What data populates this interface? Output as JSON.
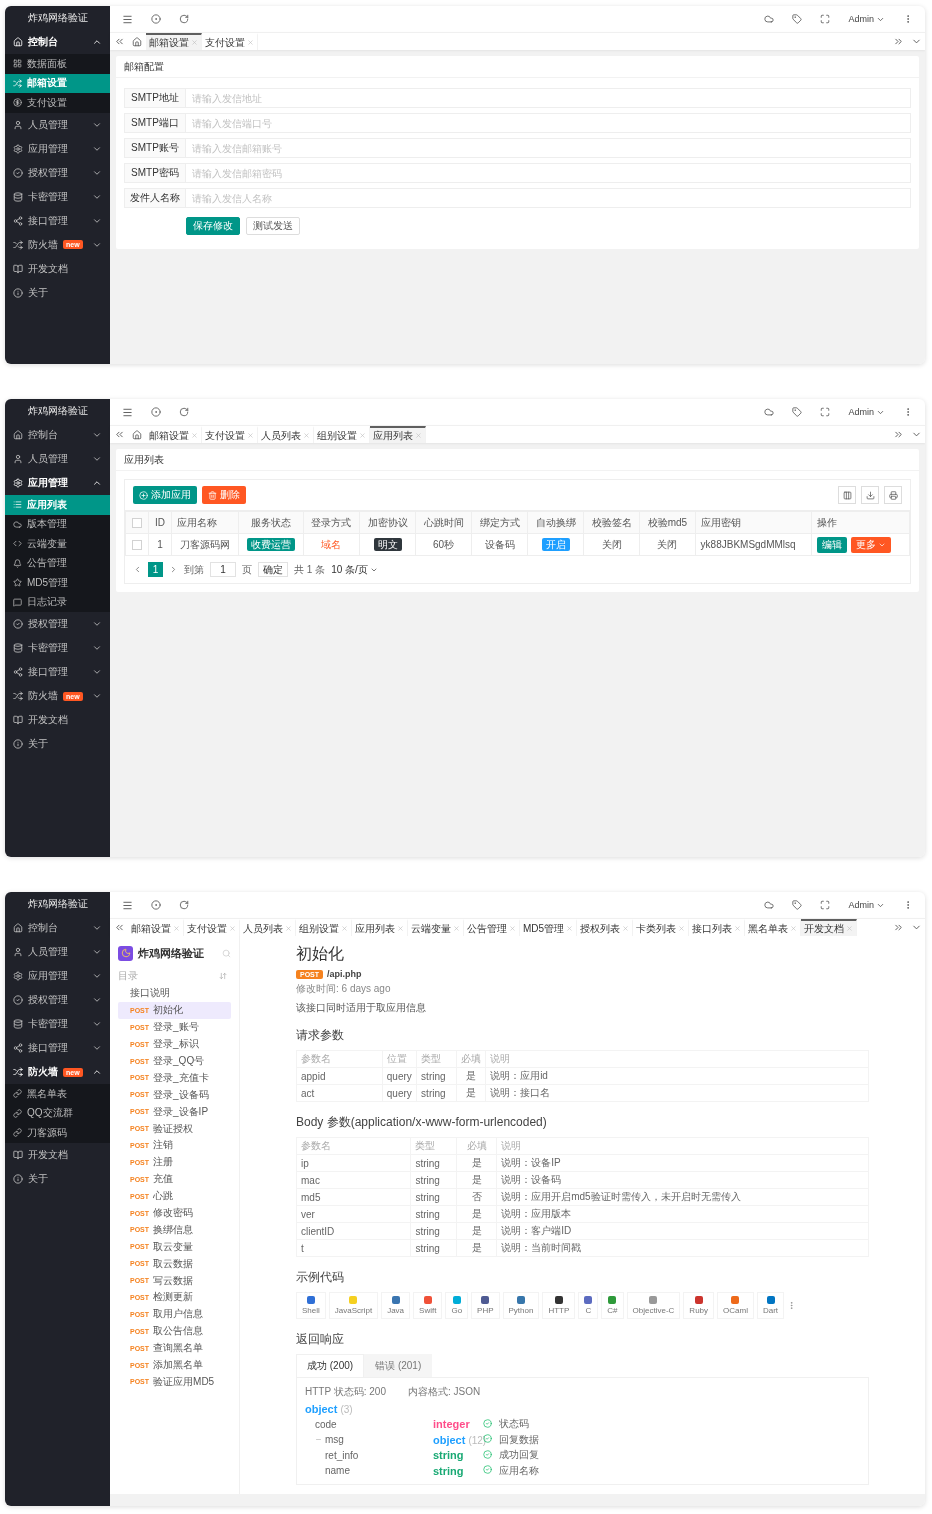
{
  "panels": [
    {
      "brand": "炸鸡网络验证",
      "user": "Admin",
      "sidebar": [
        {
          "label": "控制台",
          "expanded": true,
          "children": [
            {
              "label": "数据面板",
              "selected": false
            },
            {
              "label": "邮箱设置",
              "selected": true
            },
            {
              "label": "支付设置",
              "selected": false
            }
          ]
        },
        {
          "label": "人员管理",
          "expanded": false
        },
        {
          "label": "应用管理",
          "expanded": false
        },
        {
          "label": "授权管理",
          "expanded": false
        },
        {
          "label": "卡密管理",
          "expanded": false
        },
        {
          "label": "接口管理",
          "expanded": false
        },
        {
          "label": "防火墙",
          "badge": "new",
          "expanded": false
        },
        {
          "label": "开发文档"
        },
        {
          "label": "关于"
        }
      ],
      "tabbar": {
        "home": true,
        "tabs": [
          {
            "label": "邮箱设置",
            "selected": true
          },
          {
            "label": "支付设置",
            "selected": false
          }
        ]
      },
      "content": {
        "kind": "form",
        "title": "邮箱配置",
        "fields": [
          {
            "label": "SMTP地址",
            "placeholder": "请输入发信地址"
          },
          {
            "label": "SMTP端口",
            "placeholder": "请输入发信端口号"
          },
          {
            "label": "SMTP账号",
            "placeholder": "请输入发信邮箱账号"
          },
          {
            "label": "SMTP密码",
            "placeholder": "请输入发信邮箱密码"
          },
          {
            "label": "发件人名称",
            "placeholder": "请输入发信人名称"
          }
        ],
        "buttons": [
          {
            "label": "保存修改",
            "kind": "primary"
          },
          {
            "label": "测试发送",
            "kind": "default"
          }
        ]
      }
    },
    {
      "brand": "炸鸡网络验证",
      "user": "Admin",
      "sidebar": [
        {
          "label": "控制台",
          "expanded": false
        },
        {
          "label": "人员管理",
          "expanded": false
        },
        {
          "label": "应用管理",
          "expanded": true,
          "children": [
            {
              "label": "应用列表",
              "selected": true
            },
            {
              "label": "版本管理",
              "selected": false
            },
            {
              "label": "云端变量",
              "selected": false
            },
            {
              "label": "公告管理",
              "selected": false
            },
            {
              "label": "MD5管理",
              "selected": false
            },
            {
              "label": "日志记录",
              "selected": false
            }
          ]
        },
        {
          "label": "授权管理",
          "expanded": false
        },
        {
          "label": "卡密管理",
          "expanded": false
        },
        {
          "label": "接口管理",
          "expanded": false
        },
        {
          "label": "防火墙",
          "badge": "new",
          "expanded": false
        },
        {
          "label": "开发文档"
        },
        {
          "label": "关于"
        }
      ],
      "tabbar": {
        "home": true,
        "tabs": [
          {
            "label": "邮箱设置",
            "selected": false
          },
          {
            "label": "支付设置",
            "selected": false
          },
          {
            "label": "人员列表",
            "selected": false
          },
          {
            "label": "组别设置",
            "selected": false
          },
          {
            "label": "应用列表",
            "selected": true
          }
        ]
      },
      "content": {
        "kind": "table",
        "title": "应用列表",
        "toolbar": [
          {
            "label": "添加应用",
            "kind": "add"
          },
          {
            "label": "删除",
            "kind": "delete"
          }
        ],
        "select_all": false,
        "columns": [
          "ID",
          "应用名称",
          "服务状态",
          "登录方式",
          "加密协议",
          "心跳时间",
          "绑定方式",
          "自动换绑",
          "校验签名",
          "校验md5",
          "应用密钥",
          "操作"
        ],
        "rows": [
          {
            "checked": false,
            "cells": [
              {
                "kind": "text",
                "text": "1"
              },
              {
                "kind": "text",
                "text": "刀客源码网"
              },
              {
                "kind": "tag",
                "text": "收费运营",
                "color": "#009688"
              },
              {
                "kind": "accent",
                "text": "域名"
              },
              {
                "kind": "tag",
                "text": "明文",
                "color": "#2f363c"
              },
              {
                "kind": "text",
                "text": "60秒"
              },
              {
                "kind": "text",
                "text": "设备码"
              },
              {
                "kind": "tag",
                "text": "开启",
                "color": "#1e9fff"
              },
              {
                "kind": "text",
                "text": "关闭"
              },
              {
                "kind": "text",
                "text": "关闭"
              },
              {
                "kind": "text",
                "text": "yk88JBKMSgdMMlsq"
              },
              {
                "kind": "actions",
                "buttons": [
                  {
                    "label": "编辑",
                    "kind": "plain",
                    "color": "#009688"
                  },
                  {
                    "label": "更多",
                    "kind": "dropdown",
                    "color": "#ff5722"
                  }
                ]
              }
            ]
          }
        ],
        "pagination": {
          "pages": [
            {
              "label": "1",
              "selected": true
            }
          ],
          "goto": "到第",
          "goto_value": "1",
          "unit": "页",
          "confirm": "确定",
          "total": "共 1 条",
          "size": "10 条/页"
        }
      }
    },
    {
      "brand": "炸鸡网络验证",
      "user": "Admin",
      "sidebar": [
        {
          "label": "控制台",
          "expanded": false
        },
        {
          "label": "人员管理",
          "expanded": false
        },
        {
          "label": "应用管理",
          "expanded": false
        },
        {
          "label": "授权管理",
          "expanded": false
        },
        {
          "label": "卡密管理",
          "expanded": false
        },
        {
          "label": "接口管理",
          "expanded": false
        },
        {
          "label": "防火墙",
          "badge": "new",
          "expanded": true,
          "children": [
            {
              "label": "黑名单表",
              "selected": false
            },
            {
              "label": "QQ交流群",
              "selected": false
            },
            {
              "label": "刀客源码",
              "selected": false
            }
          ]
        },
        {
          "label": "开发文档"
        },
        {
          "label": "关于"
        }
      ],
      "tabbar": {
        "home": false,
        "tabs": [
          {
            "label": "邮箱设置",
            "selected": false
          },
          {
            "label": "支付设置",
            "selected": false
          },
          {
            "label": "人员列表",
            "selected": false
          },
          {
            "label": "组别设置",
            "selected": false
          },
          {
            "label": "应用列表",
            "selected": false
          },
          {
            "label": "云端变量",
            "selected": false
          },
          {
            "label": "公告管理",
            "selected": false
          },
          {
            "label": "MD5管理",
            "selected": false
          },
          {
            "label": "授权列表",
            "selected": false
          },
          {
            "label": "卡类列表",
            "selected": false
          },
          {
            "label": "接口列表",
            "selected": false
          },
          {
            "label": "黑名单表",
            "selected": false
          },
          {
            "label": "开发文档",
            "selected": true
          }
        ]
      },
      "content": {
        "kind": "docs",
        "nav": {
          "brand": "炸鸡网络验证",
          "toc": "目录",
          "items": [
            {
              "label": "接口说明",
              "selected": false
            },
            {
              "method": "POST",
              "label": "初始化",
              "selected": true
            },
            {
              "method": "POST",
              "label": "登录_账号",
              "selected": false
            },
            {
              "method": "POST",
              "label": "登录_标识",
              "selected": false
            },
            {
              "method": "POST",
              "label": "登录_QQ号",
              "selected": false
            },
            {
              "method": "POST",
              "label": "登录_充值卡",
              "selected": false
            },
            {
              "method": "POST",
              "label": "登录_设备码",
              "selected": false
            },
            {
              "method": "POST",
              "label": "登录_设备IP",
              "selected": false
            },
            {
              "method": "POST",
              "label": "验证授权",
              "selected": false
            },
            {
              "method": "POST",
              "label": "注销",
              "selected": false
            },
            {
              "method": "POST",
              "label": "注册",
              "selected": false
            },
            {
              "method": "POST",
              "label": "充值",
              "selected": false
            },
            {
              "method": "POST",
              "label": "心跳",
              "selected": false
            },
            {
              "method": "POST",
              "label": "修改密码",
              "selected": false
            },
            {
              "method": "POST",
              "label": "换绑信息",
              "selected": false
            },
            {
              "method": "POST",
              "label": "取云变量",
              "selected": false
            },
            {
              "method": "POST",
              "label": "取云数据",
              "selected": false
            },
            {
              "method": "POST",
              "label": "写云数据",
              "selected": false
            },
            {
              "method": "POST",
              "label": "检测更新",
              "selected": false
            },
            {
              "method": "POST",
              "label": "取用户信息",
              "selected": false
            },
            {
              "method": "POST",
              "label": "取公告信息",
              "selected": false
            },
            {
              "method": "POST",
              "label": "查询黑名单",
              "selected": false
            },
            {
              "method": "POST",
              "label": "添加黑名单",
              "selected": false
            },
            {
              "method": "POST",
              "label": "验证应用MD5",
              "selected": false
            }
          ]
        },
        "doc": {
          "title": "初始化",
          "method": "POST",
          "path": "/api.php",
          "modified": "修改时间: 6 days ago",
          "description": "该接口同时适用于取应用信息",
          "query_title": "请求参数",
          "query_columns": [
            "参数名",
            "位置",
            "类型",
            "必填",
            "说明"
          ],
          "query_rows": [
            [
              "appid",
              "query",
              "string",
              "是",
              "说明：应用id"
            ],
            [
              "act",
              "query",
              "string",
              "是",
              "说明：接口名"
            ]
          ],
          "body_title": "Body 参数(application/x-www-form-urlencoded)",
          "body_columns": [
            "参数名",
            "类型",
            "必填",
            "说明"
          ],
          "body_rows": [
            [
              "ip",
              "string",
              "是",
              "说明：设备IP"
            ],
            [
              "mac",
              "string",
              "是",
              "说明：设备码"
            ],
            [
              "md5",
              "string",
              "否",
              "说明：应用开启md5验证时需传入，未开启时无需传入"
            ],
            [
              "ver",
              "string",
              "是",
              "说明：应用版本"
            ],
            [
              "clientID",
              "string",
              "是",
              "说明：客户端ID"
            ],
            [
              "t",
              "string",
              "是",
              "说明：当前时间戳"
            ]
          ],
          "code_title": "示例代码",
          "languages": [
            {
              "label": "Shell",
              "color": "#2f6fd6"
            },
            {
              "label": "JavaScript",
              "color": "#f5d020"
            },
            {
              "label": "Java",
              "color": "#3a75b0"
            },
            {
              "label": "Swift",
              "color": "#f05138"
            },
            {
              "label": "Go",
              "color": "#00add8"
            },
            {
              "label": "PHP",
              "color": "#4f5b93"
            },
            {
              "label": "Python",
              "color": "#3776ab"
            },
            {
              "label": "HTTP",
              "color": "#333333"
            },
            {
              "label": "C",
              "color": "#5c6bc0"
            },
            {
              "label": "C#",
              "color": "#2e9a3a"
            },
            {
              "label": "Objective-C",
              "color": "#999999"
            },
            {
              "label": "Ruby",
              "color": "#cc342d"
            },
            {
              "label": "OCaml",
              "color": "#ee6a1a"
            },
            {
              "label": "Dart",
              "color": "#0175c2"
            }
          ],
          "response_title": "返回响应",
          "response_tabs": [
            {
              "label": "成功 (200)",
              "selected": true
            },
            {
              "label": "错误 (201)",
              "selected": false
            }
          ],
          "status": "HTTP 状态码: 200",
          "format": "内容格式: JSON",
          "schema": {
            "type": "object",
            "count": "(3)",
            "color": "#1e9fff",
            "children": [
              {
                "name": "code",
                "type": "integer",
                "color": "#ff4d8a",
                "required": true,
                "description": "状态码"
              },
              {
                "name": "msg",
                "type": "object",
                "count": "(12)",
                "color": "#1e9fff",
                "required": true,
                "description": "回复数据",
                "expanded": true,
                "children": [
                  {
                    "name": "ret_info",
                    "type": "string",
                    "color": "#19a974",
                    "required": true,
                    "description": "成功回复"
                  },
                  {
                    "name": "name",
                    "type": "string",
                    "color": "#19a974",
                    "required": true,
                    "description": "应用名称"
                  }
                ]
              }
            ]
          }
        }
      }
    }
  ]
}
